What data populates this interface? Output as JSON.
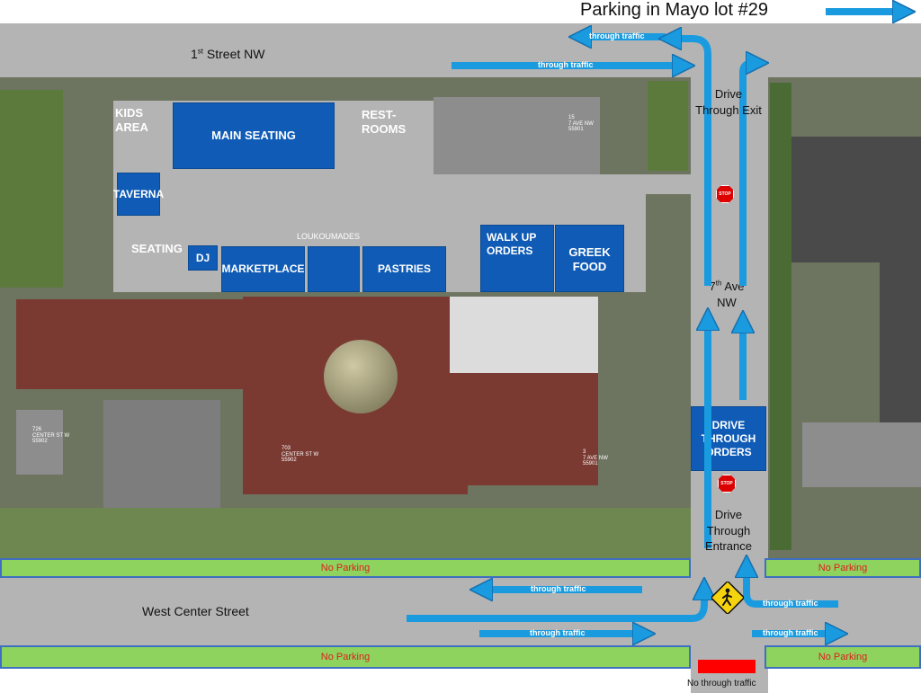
{
  "header": {
    "title": "Parking in Mayo lot #29"
  },
  "streets": {
    "first_street": "1st Street NW",
    "seventh_ave_a": "7th Ave",
    "seventh_ave_b": "NW",
    "west_center": "West Center Street"
  },
  "lot_labels": {
    "kids_area_a": "KIDS",
    "kids_area_b": "AREA",
    "restrooms_a": "REST-",
    "restrooms_b": "ROOMS",
    "seating": "SEATING",
    "loukoumades": "LOUKOUMADES"
  },
  "blocks": {
    "main_seating": "MAIN SEATING",
    "taverna": "TAVERNA",
    "dj": "DJ",
    "marketplace": "MARKETPLACE",
    "pastries": "PASTRIES",
    "walk_up_a": "WALK UP",
    "walk_up_b": "ORDERS",
    "greek_food_a": "GREEK",
    "greek_food_b": "FOOD",
    "drive_through_a": "DRIVE",
    "drive_through_b": "THROUGH",
    "drive_through_c": "ORDERS"
  },
  "side_labels": {
    "exit_a": "Drive",
    "exit_b": "Through Exit",
    "entrance_a": "Drive",
    "entrance_b": "Through",
    "entrance_c": "Entrance",
    "no_through": "No through traffic"
  },
  "traffic": {
    "through": "through traffic"
  },
  "no_parking": {
    "label": "No Parking"
  },
  "signs": {
    "stop": "STOP"
  },
  "addresses": {
    "a1_a": "15",
    "a1_b": "7 AVE NW",
    "a1_c": "55901",
    "a2_a": "726",
    "a2_b": "CENTER ST W",
    "a2_c": "55902",
    "a3_a": "703",
    "a3_b": "CENTER ST W",
    "a3_c": "55902",
    "a4_a": "3",
    "a4_b": "7 AVE NW",
    "a4_c": "55901"
  },
  "colors": {
    "arrow": "#1a9be0",
    "block": "#0f5bb5",
    "no_parking_fill": "#8fd35f",
    "no_parking_text": "#e01b1b",
    "road": "#b4b4b4"
  }
}
